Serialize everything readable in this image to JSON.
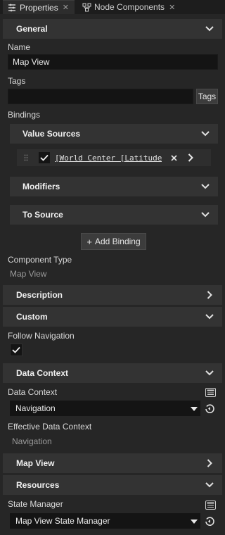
{
  "tabs": [
    {
      "label": "Properties",
      "icon": "properties-icon",
      "active": true
    },
    {
      "label": "Node Components",
      "icon": "node-components-icon",
      "active": false
    }
  ],
  "sections": {
    "general": "General",
    "description": "Description",
    "custom": "Custom",
    "data_context": "Data Context",
    "map_view": "Map View",
    "resources": "Resources"
  },
  "general": {
    "name_label": "Name",
    "name_value": "Map View",
    "tags_label": "Tags",
    "tags_value": "",
    "tags_button": "Tags",
    "bindings_label": "Bindings",
    "value_sources": "Value Sources",
    "binding_item": "[World Center [Latitude",
    "binding_checked": true,
    "modifiers": "Modifiers",
    "to_source": "To Source",
    "add_binding": "Add Binding",
    "component_type_label": "Component Type",
    "component_type_value": "Map View"
  },
  "custom": {
    "follow_navigation_label": "Follow Navigation",
    "follow_navigation_checked": true
  },
  "data_context": {
    "data_context_label": "Data Context",
    "data_context_value": "Navigation",
    "effective_label": "Effective Data Context",
    "effective_value": "Navigation"
  },
  "resources": {
    "state_manager_label": "State Manager",
    "state_manager_value": "Map View State Manager"
  },
  "colors": {
    "background": "#262626",
    "section": "#333333",
    "input": "#141414",
    "text": "#d4d4d4"
  }
}
